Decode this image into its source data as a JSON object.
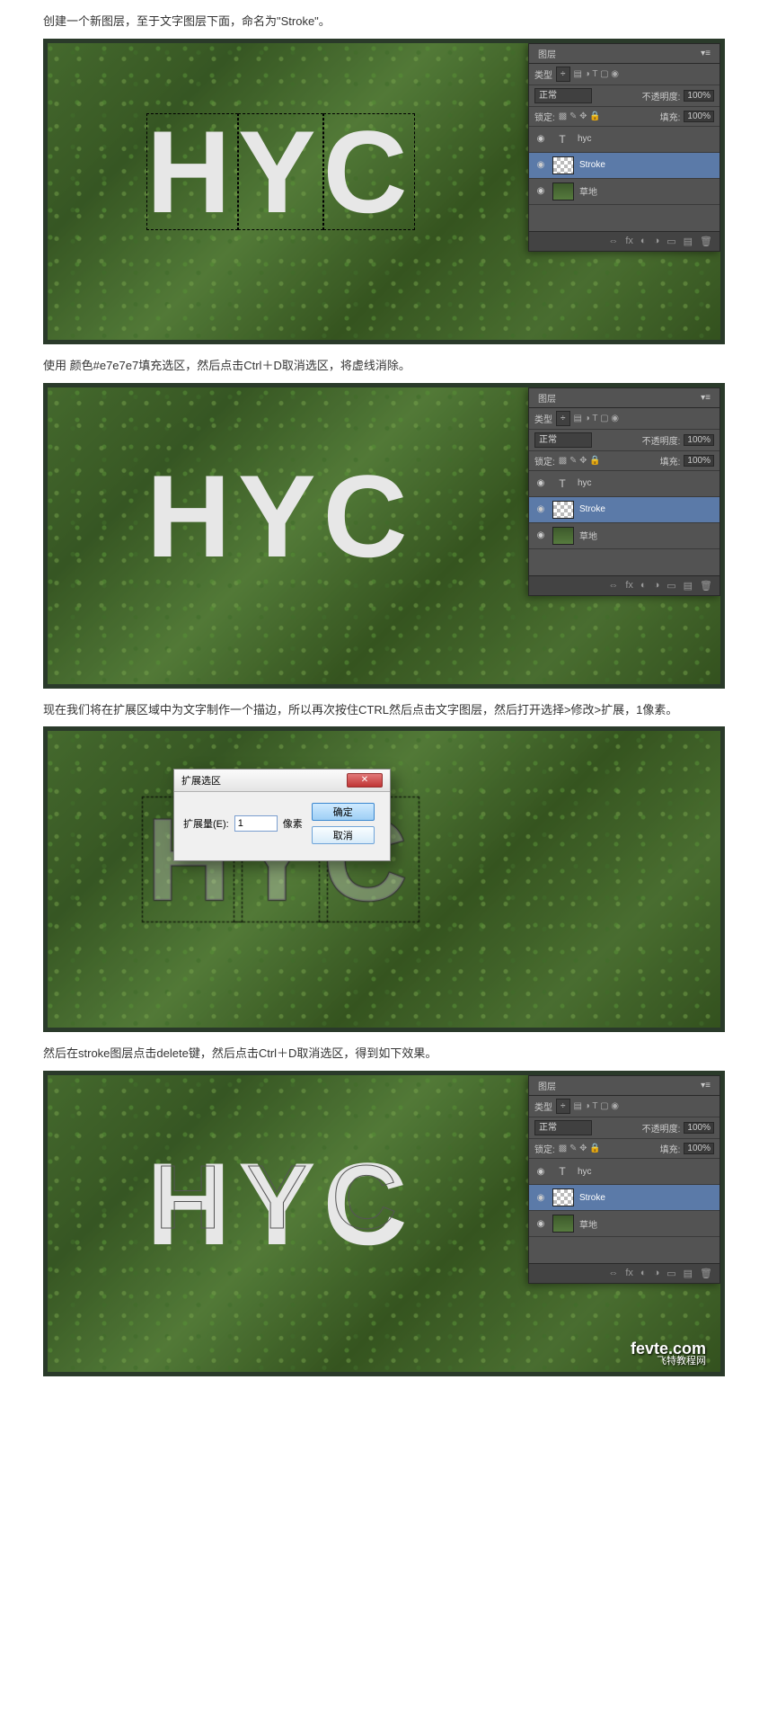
{
  "step1_text": "创建一个新图层，至于文字图层下面，命名为\"Stroke\"。",
  "step2_text": "使用 颜色#e7e7e7填充选区，然后点击Ctrl＋D取消选区，将虚线消除。",
  "step3_text": "现在我们将在扩展区域中为文字制作一个描边，所以再次按住CTRL然后点击文字图层，然后打开选择>修改>扩展，1像素。",
  "step4_text": "然后在stroke图层点击delete键，然后点击Ctrl＋D取消选区，得到如下效果。",
  "hyc": "HYC",
  "panel": {
    "title": "图层",
    "filter_label": "类型",
    "blend_mode": "正常",
    "opacity_label": "不透明度:",
    "opacity_val": "100%",
    "lock_label": "锁定:",
    "fill_label": "填充:",
    "fill_val": "100%",
    "layers": {
      "text_layer": "hyc",
      "stroke_layer": "Stroke",
      "bg_layer": "草地"
    },
    "close_glyph": "▾"
  },
  "dialog": {
    "title": "扩展选区",
    "field_label": "扩展量(E):",
    "value": "1",
    "unit": "像素",
    "ok": "确定",
    "cancel": "取消",
    "close": "✕"
  },
  "watermark": {
    "brand": "fevte.com",
    "zh": "飞特教程网"
  }
}
